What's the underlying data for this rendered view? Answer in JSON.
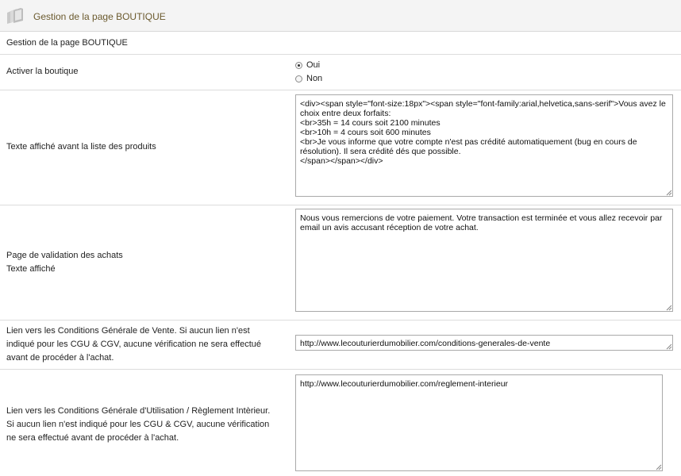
{
  "header": {
    "title": "Gestion de la page BOUTIQUE",
    "icon": "folder-icon"
  },
  "section": {
    "title": "Gestion de la page BOUTIQUE"
  },
  "activer": {
    "label": "Activer la boutique",
    "options": [
      {
        "label": "Oui",
        "selected": true
      },
      {
        "label": "Non",
        "selected": false
      }
    ]
  },
  "texte_avant": {
    "label": "Texte affiché avant la liste des produits",
    "value": "<div><span style=\"font-size:18px\"><span style=\"font-family:arial,helvetica,sans-serif\">Vous avez le choix entre deux forfaits:\n<br>35h = 14 cours soit 2100 minutes\n<br>10h = 4 cours soit 600 minutes\n<br>Je vous informe que votre compte n'est pas crédité automatiquement (bug en cours de résolution). Il sera crédité dés que possible.\n</span></span></div>"
  },
  "validation": {
    "label_line1": "Page de validation des achats",
    "label_line2": "Texte affiché",
    "value": "Nous vous remercions de votre paiement. Votre transaction est terminée et vous allez recevoir par email un avis accusant réception de votre achat."
  },
  "cgv": {
    "label": "Lien vers les Conditions Générale de Vente. Si aucun lien n'est indiqué pour les CGU & CGV, aucune vérification ne sera effectué avant de procéder à l'achat.",
    "value": "http://www.lecouturierdumobilier.com/conditions-generales-de-vente"
  },
  "cgu": {
    "label": "Lien vers les Conditions Générale d'Utilisation / Règlement Intèrieur. Si aucun lien n'est indiqué pour les CGU & CGV, aucune vérification ne sera effectué avant de procéder à l'achat.",
    "value": "http://www.lecouturierdumobilier.com/reglement-interieur"
  }
}
